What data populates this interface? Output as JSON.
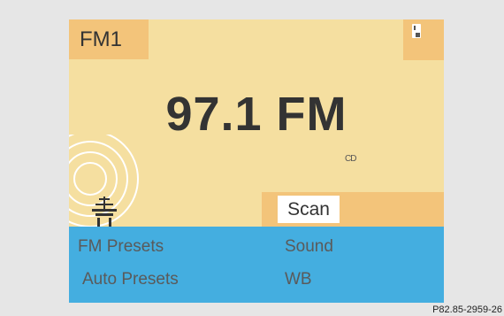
{
  "header": {
    "band": "FM1"
  },
  "station": {
    "frequency": "97.1 FM",
    "rds_indicator": "CD"
  },
  "controls": {
    "scan_label": "Scan"
  },
  "menu": {
    "fm_presets": "FM Presets",
    "sound": "Sound",
    "auto_presets": "Auto Presets",
    "wb": "WB"
  },
  "figure_ref": "P82.85-2959-26",
  "icons": {
    "corner": "device-indicator-icon",
    "signal": "radio-tower-signal-icon"
  },
  "colors": {
    "screen_background": "#f5dfa0",
    "highlight": "#f3c47a",
    "menu_background": "#44aee0",
    "page_background": "#e6e6e6",
    "text": "#333333"
  }
}
